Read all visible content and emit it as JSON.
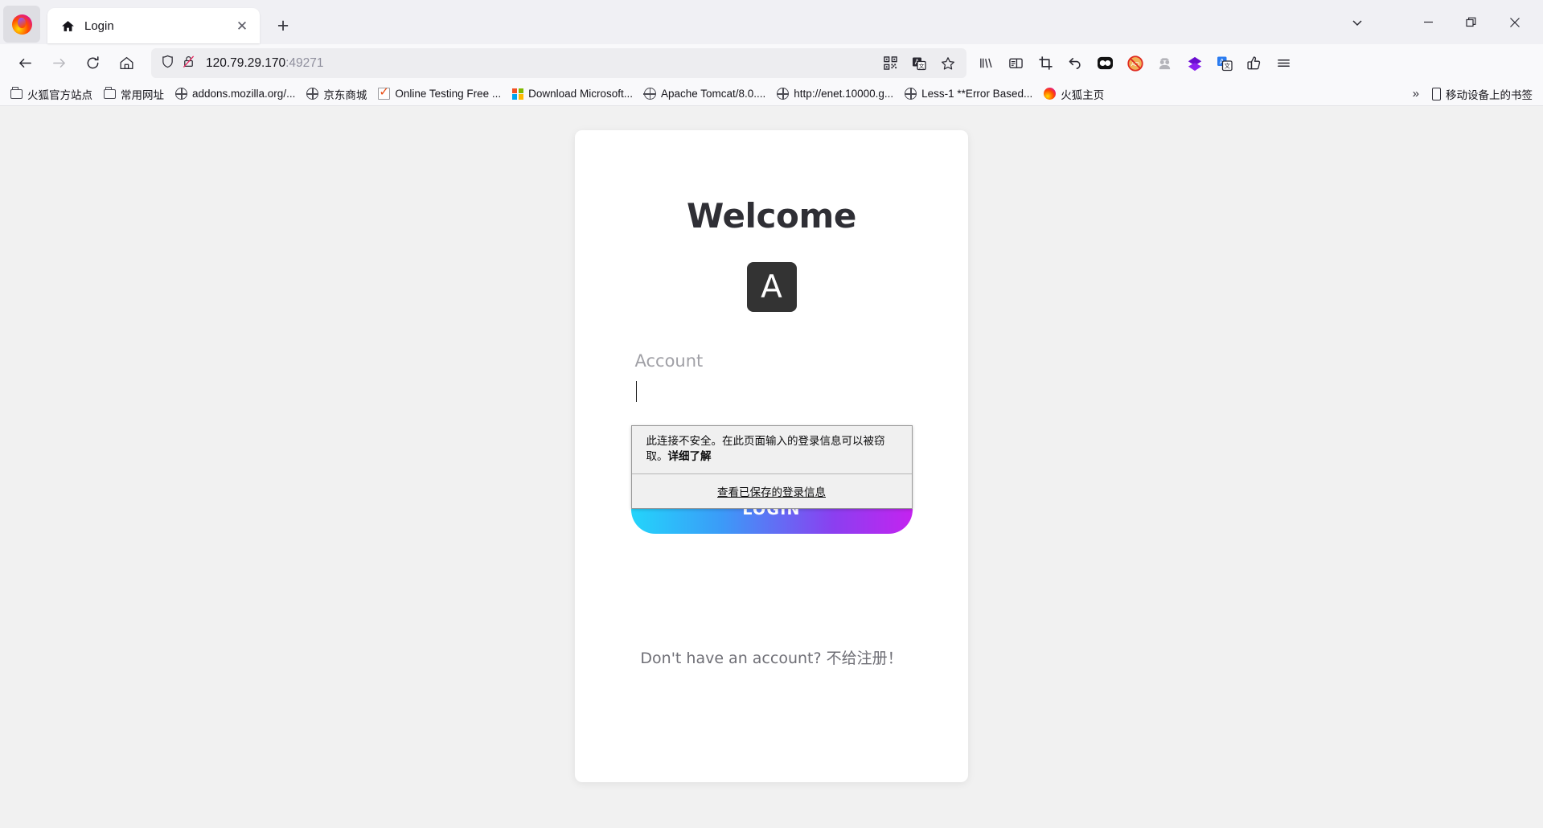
{
  "window": {
    "controls": {
      "list_all_tabs": "chevron-down",
      "minimize": "—",
      "restore": "restore",
      "close": "✕"
    }
  },
  "tabs": [
    {
      "title": "Login",
      "favicon": "home-icon",
      "close": "✕"
    }
  ],
  "newtab_label": "+",
  "nav": {
    "back": "←",
    "forward": "→",
    "reload": "↻",
    "home": "home-icon"
  },
  "urlbar": {
    "shield_icon": "shield-icon",
    "insecure_icon": "lock-crossed-icon",
    "url_host": "120.79.29.170",
    "url_port": ":49271",
    "full_url": "120.79.29.170:49271",
    "qr_icon": "qr-code-icon",
    "translate_icon": "translate-icon",
    "bookmark_star_icon": "star-icon"
  },
  "toolbar_right": [
    {
      "name": "library-icon",
      "glyph": "library"
    },
    {
      "name": "sidebar-icon",
      "glyph": "sidebar"
    },
    {
      "name": "screenshot-crop-icon",
      "glyph": "crop"
    },
    {
      "name": "undo-arrow-icon",
      "glyph": "undo"
    },
    {
      "name": "dark-reader-icon",
      "glyph": "darkreader"
    },
    {
      "name": "adblock-icon",
      "glyph": "adblock"
    },
    {
      "name": "anonymous-person-icon",
      "glyph": "person"
    },
    {
      "name": "diamond-extension-icon",
      "glyph": "diamond"
    },
    {
      "name": "translate-extension-icon",
      "glyph": "translate"
    },
    {
      "name": "thumbs-up-extension-icon",
      "glyph": "thumb"
    },
    {
      "name": "app-menu-icon",
      "glyph": "hamburger"
    }
  ],
  "bookmarks": {
    "items": [
      {
        "label": "火狐官方站点",
        "icon": "folder"
      },
      {
        "label": "常用网址",
        "icon": "folder"
      },
      {
        "label": "addons.mozilla.org/...",
        "icon": "globe"
      },
      {
        "label": "京东商城",
        "icon": "globe"
      },
      {
        "label": "Online Testing Free ...",
        "icon": "check"
      },
      {
        "label": "Download Microsoft...",
        "icon": "microsoft"
      },
      {
        "label": "Apache Tomcat/8.0....",
        "icon": "globe"
      },
      {
        "label": "http://enet.10000.g...",
        "icon": "globe"
      },
      {
        "label": "Less-1 **Error Based...",
        "icon": "globe"
      },
      {
        "label": "火狐主页",
        "icon": "firefox"
      }
    ],
    "overflow_chevron": "»",
    "mobile_bookmarks": {
      "label": "移动设备上的书签",
      "icon": "phone"
    }
  },
  "page": {
    "heading": "Welcome",
    "logo_letter": "A",
    "account_label": "Account",
    "account_value": "",
    "account_placeholder": "",
    "login_button": "LOGIN",
    "signup_text": "Don't have an account? 不给注册！",
    "colors": {
      "button_gradient_start": "#23d5fb",
      "button_gradient_end": "#c423f0",
      "logo_background": "#333333",
      "heading_color": "#2f2f35",
      "page_background": "#f1f1f1",
      "card_background": "#ffffff"
    }
  },
  "insecure_popup": {
    "message_plain": "此连接不安全。在此页面输入的登录信息可以被窃取。",
    "message_link": "详细了解",
    "action": "查看已保存的登录信息"
  }
}
